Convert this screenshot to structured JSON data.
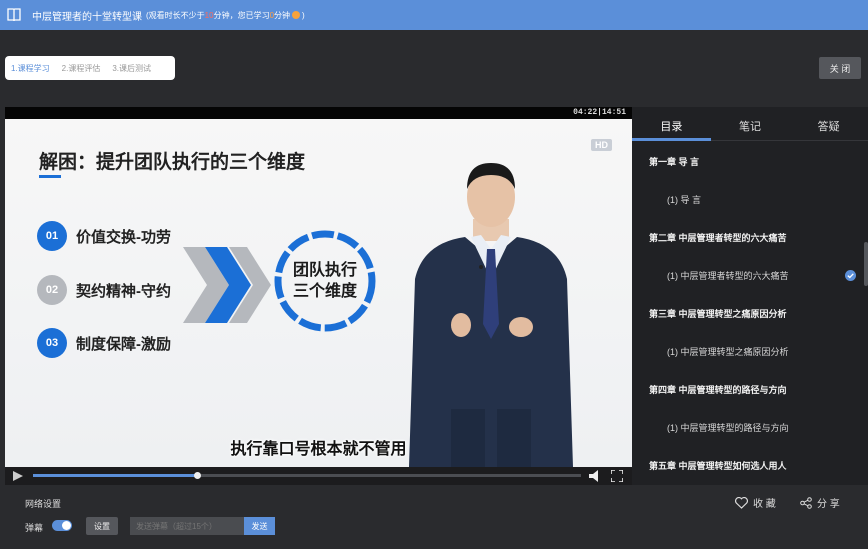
{
  "header": {
    "title": "中层管理者的十堂转型课",
    "note_prefix": "(观看时长不少于",
    "note_required": "10",
    "note_mid": "分钟，您已学习",
    "note_watched": "0",
    "note_suffix": "分钟",
    "note_end": ")"
  },
  "steps": [
    "1.课程学习",
    "2.课程评估",
    "3.课后测试"
  ],
  "close_label": "关 闭",
  "player": {
    "time_current": "04:22",
    "time_total": "14:51",
    "progress": 0.3,
    "hd_label": "HD",
    "slide_title": "解困：提升团队执行的三个维度",
    "dimensions": [
      {
        "num": "01",
        "label": "价值交换-功劳",
        "color": "#1b6fd6"
      },
      {
        "num": "02",
        "label": "契约精神-守约",
        "color": "#b5b8bd"
      },
      {
        "num": "03",
        "label": "制度保障-激励",
        "color": "#1b6fd6"
      }
    ],
    "circle_line1": "团队执行",
    "circle_line2": "三个维度",
    "subtitle": "执行靠口号根本就不管用"
  },
  "sidebar": {
    "tabs": [
      "目录",
      "笔记",
      "答疑"
    ],
    "toc": [
      {
        "type": "chapter",
        "label": "第一章 导 言"
      },
      {
        "type": "lesson",
        "label": "(1) 导 言"
      },
      {
        "type": "chapter",
        "label": "第二章 中层管理者转型的六大痛苦"
      },
      {
        "type": "lesson",
        "label": "(1) 中层管理者转型的六大痛苦",
        "done": true
      },
      {
        "type": "chapter",
        "label": "第三章 中层管理转型之痛原因分析"
      },
      {
        "type": "lesson",
        "label": "(1) 中层管理转型之痛原因分析"
      },
      {
        "type": "chapter",
        "label": "第四章 中层管理转型的路径与方向"
      },
      {
        "type": "lesson",
        "label": "(1) 中层管理转型的路径与方向"
      },
      {
        "type": "chapter",
        "label": "第五章 中层管理转型如何选人用人"
      }
    ]
  },
  "bottom": {
    "network": "网络设置",
    "favorite": "收 藏",
    "share": "分 享",
    "danmu": "弹幕",
    "settings": "设置",
    "input_placeholder": "发送弹幕（超过15个）",
    "send": "发送"
  }
}
